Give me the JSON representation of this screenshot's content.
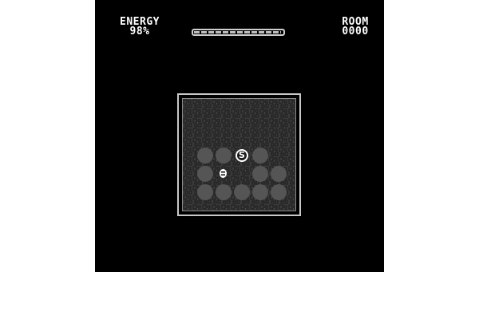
{
  "hud": {
    "energy_label": "ENERGY",
    "energy_value": "98%",
    "energy_level": 0.98,
    "room_label": "ROOM",
    "room_value": "0000"
  },
  "room": {
    "save_token_label": "S",
    "boulder_rows": [
      [
        1,
        1,
        0,
        1,
        0
      ],
      [
        1,
        0,
        0,
        1,
        1
      ],
      [
        1,
        1,
        1,
        1,
        1
      ]
    ]
  },
  "colors": {
    "background": "#000000",
    "hud_text": "#ffffff",
    "boulder": "#555555",
    "floor": "#3a3a3a"
  }
}
